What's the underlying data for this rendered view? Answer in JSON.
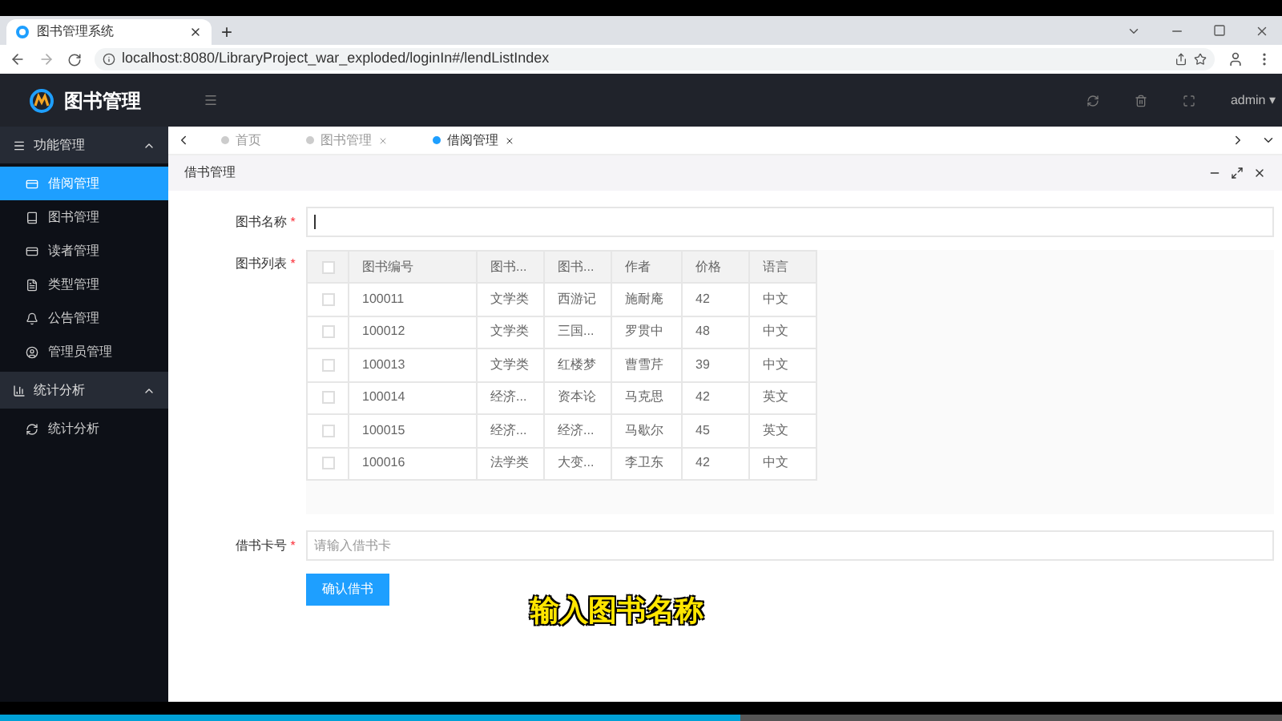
{
  "browser": {
    "tab_title": "图书管理系统",
    "new_tab": "+",
    "url": "localhost:8080/LibraryProject_war_exploded/loginIn#/lendListIndex"
  },
  "app": {
    "title": "图书管理",
    "user": "admin",
    "user_caret": "▾"
  },
  "sidebar": [
    {
      "label": "功能管理",
      "expanded": true,
      "children": [
        {
          "label": "借阅管理",
          "selected": true
        },
        {
          "label": "图书管理",
          "selected": false
        },
        {
          "label": "读者管理",
          "selected": false
        },
        {
          "label": "类型管理",
          "selected": false
        },
        {
          "label": "公告管理",
          "selected": false
        },
        {
          "label": "管理员管理",
          "selected": false
        }
      ]
    },
    {
      "label": "统计分析",
      "expanded": true,
      "children": [
        {
          "label": "统计分析",
          "selected": false
        }
      ]
    }
  ],
  "tabs": [
    {
      "label": "首页",
      "selected": false,
      "closable": false
    },
    {
      "label": "图书管理",
      "selected": false,
      "closable": true
    },
    {
      "label": "借阅管理",
      "selected": true,
      "closable": true
    }
  ],
  "panel": {
    "title": "借书管理"
  },
  "form": {
    "name_label": "图书名称",
    "name_required": "*",
    "list_label": "图书列表",
    "list_required": "*",
    "card_label": "借书卡号",
    "card_required": "*",
    "card_placeholder": "请输入借书卡",
    "submit": "确认借书"
  },
  "table": {
    "all_checked": false,
    "columns": [
      "图书编号",
      "图书...",
      "图书...",
      "作者",
      "价格",
      "语言"
    ],
    "rows": [
      {
        "checked": false,
        "cells": [
          "100011",
          "文学类",
          "西游记",
          "施耐庵",
          "42",
          "中文"
        ]
      },
      {
        "checked": false,
        "cells": [
          "100012",
          "文学类",
          "三国...",
          "罗贯中",
          "48",
          "中文"
        ]
      },
      {
        "checked": false,
        "cells": [
          "100013",
          "文学类",
          "红楼梦",
          "曹雪芹",
          "39",
          "中文"
        ]
      },
      {
        "checked": false,
        "cells": [
          "100014",
          "经济...",
          "资本论",
          "马克思",
          "42",
          "英文"
        ]
      },
      {
        "checked": false,
        "cells": [
          "100015",
          "经济...",
          "经济...",
          "马歇尔",
          "45",
          "英文"
        ]
      },
      {
        "checked": false,
        "cells": [
          "100016",
          "法学类",
          "大变...",
          "李卫东",
          "42",
          "中文"
        ]
      }
    ]
  },
  "subtitle": "输入图书名称",
  "video": {
    "level": 0.578
  }
}
